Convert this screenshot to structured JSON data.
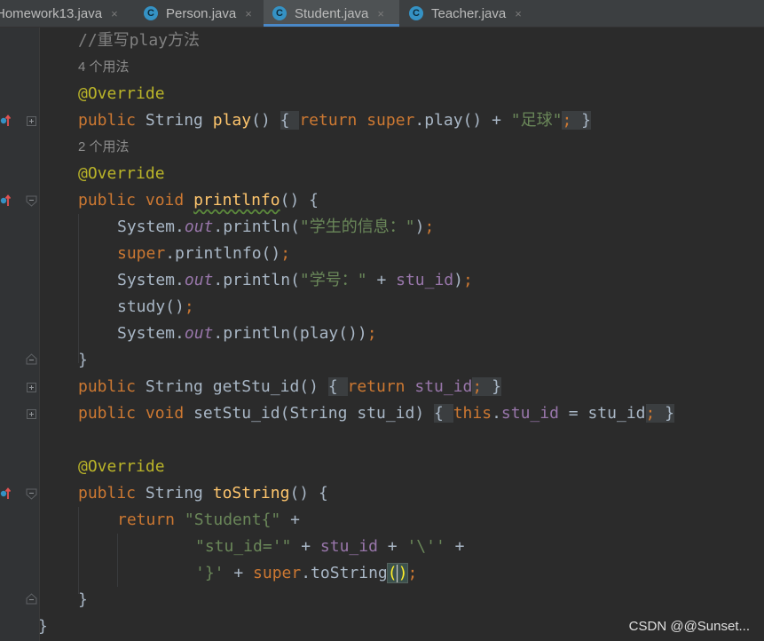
{
  "tabs": [
    {
      "label": "Homework13.java",
      "active": false,
      "icon": "none"
    },
    {
      "label": "Person.java",
      "active": false,
      "icon": "java-class-icon"
    },
    {
      "label": "Student.java",
      "active": true,
      "icon": "java-class-icon"
    },
    {
      "label": "Teacher.java",
      "active": false,
      "icon": "java-class-icon"
    }
  ],
  "tab_close": "×",
  "class_icon_letter": "C",
  "code": {
    "comment": "//重写play方法",
    "usages_play": "4 个用法",
    "override": "@Override",
    "kw_public": "public",
    "kw_return": "return",
    "kw_super": "super",
    "kw_void": "void",
    "kw_this": "this",
    "type_string": "String",
    "play_fn": "play",
    "play_call": ".play() + ",
    "str_football": "\"足球\"",
    "usages_print": "2 个用法",
    "printinfo_fn": "printlnfo",
    "system": "System.",
    "out": "out",
    "println_open": ".println(",
    "str_info": "\"学生的信息：\"",
    "super_printinfo": ".printlnfo()",
    "str_stuno": "\"学号：\"",
    "stu_id": "stu_id",
    "study_call": "study()",
    "println_play": ".println(play())",
    "get_fn": "getStu_id",
    "set_fn": "setStu_id",
    "set_params": "(String stu_id)",
    "tostring_fn": "toString",
    "str_student": "\"Student{\"",
    "str_stuid_eq": "\"stu_id='\"",
    "char_quote": "'\\''",
    "char_brace": "'}'",
    "tostring_call": ".toString"
  },
  "watermark": "CSDN @@Sunset..."
}
